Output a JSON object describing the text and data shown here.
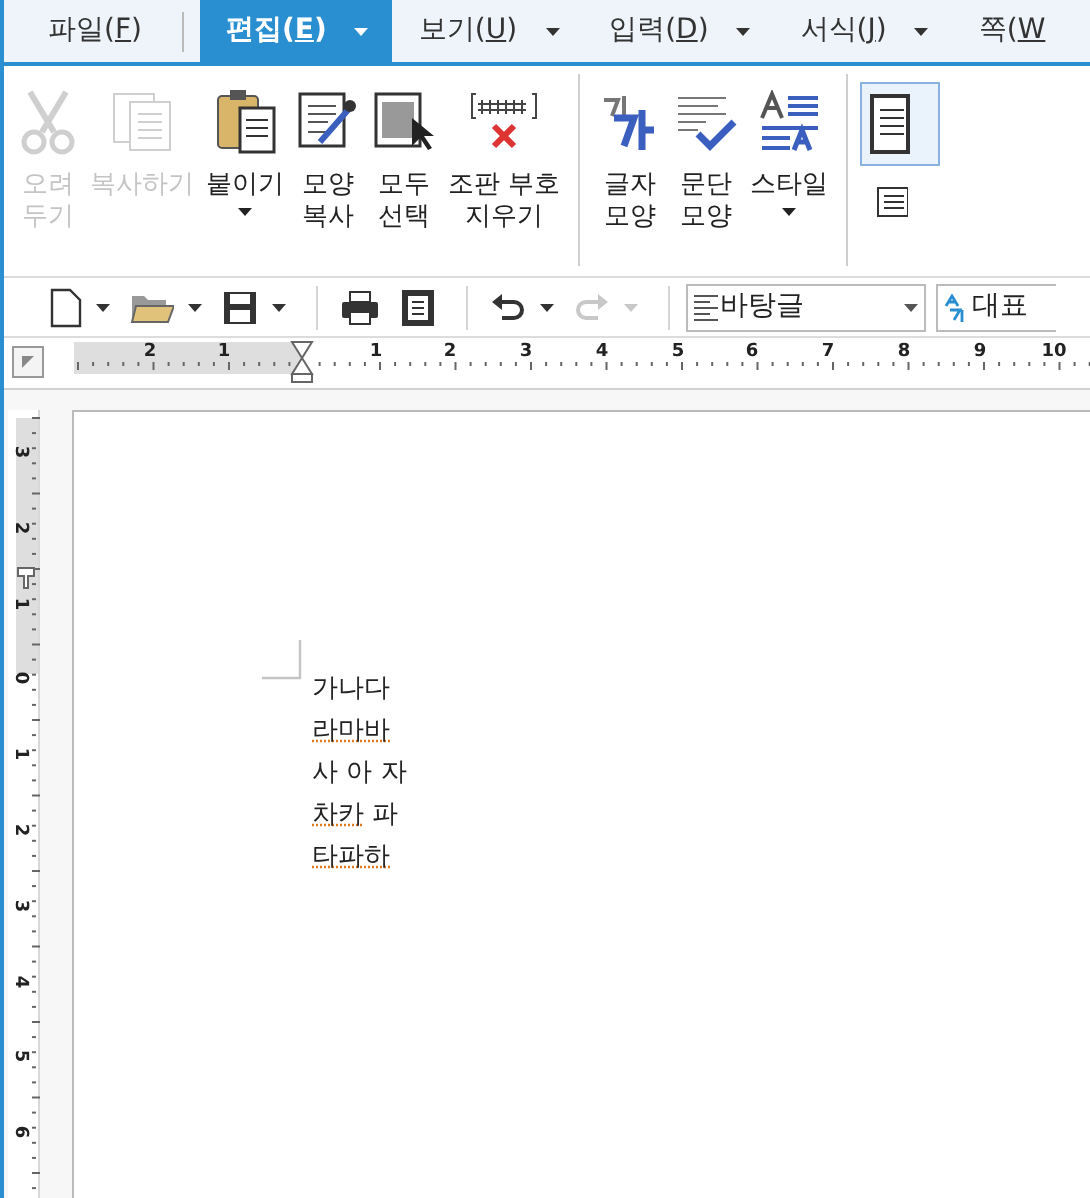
{
  "menu_tabs": [
    {
      "prefix": "파일(",
      "mnemonic": "F",
      "suffix": ")",
      "selected": false,
      "dropdown": false
    },
    {
      "prefix": "편집(",
      "mnemonic": "E",
      "suffix": ")",
      "selected": true,
      "dropdown": true
    },
    {
      "prefix": "보기(",
      "mnemonic": "U",
      "suffix": ")",
      "selected": false,
      "dropdown": true
    },
    {
      "prefix": "입력(",
      "mnemonic": "D",
      "suffix": ")",
      "selected": false,
      "dropdown": true
    },
    {
      "prefix": "서식(",
      "mnemonic": "J",
      "suffix": ")",
      "selected": false,
      "dropdown": true
    },
    {
      "prefix": "쪽(",
      "mnemonic": "W",
      "selected": false,
      "dropdown": false
    }
  ],
  "ribbon_groups": [
    [
      {
        "kind": "cut",
        "label": "오려\n두기",
        "disabled": true,
        "dropdown": false
      },
      {
        "kind": "copy",
        "label": "복사하기",
        "disabled": true,
        "dropdown": false
      },
      {
        "kind": "paste",
        "label": "붙이기",
        "disabled": false,
        "dropdown": true
      },
      {
        "kind": "format-painter",
        "label": "모양\n복사",
        "disabled": false,
        "dropdown": false
      },
      {
        "kind": "select-all",
        "label": "모두\n선택",
        "disabled": false,
        "dropdown": false
      },
      {
        "kind": "clear-codes",
        "label": "조판 부호\n지우기",
        "disabled": false,
        "dropdown": false
      }
    ],
    [
      {
        "kind": "char-shape",
        "label": "글자\n모양",
        "disabled": false,
        "dropdown": false
      },
      {
        "kind": "para-shape",
        "label": "문단\n모양",
        "disabled": false,
        "dropdown": false
      },
      {
        "kind": "style",
        "label": "스타일",
        "disabled": false,
        "dropdown": true
      }
    ]
  ],
  "toolbar_groups": [
    [
      {
        "kind": "new",
        "disabled": false,
        "dropdown": true
      },
      {
        "kind": "open",
        "disabled": false,
        "dropdown": true
      },
      {
        "kind": "save",
        "disabled": false,
        "dropdown": true
      }
    ],
    [
      {
        "kind": "print",
        "disabled": false,
        "dropdown": false
      },
      {
        "kind": "preview",
        "disabled": false,
        "dropdown": false
      }
    ],
    [
      {
        "kind": "undo",
        "disabled": false,
        "dropdown": true
      },
      {
        "kind": "redo",
        "disabled": true,
        "dropdown": true
      }
    ]
  ],
  "style_select": {
    "value": "바탕글"
  },
  "font_select": {
    "value": "대표"
  },
  "horizontal_ruler": {
    "labels": [
      "2",
      "1",
      "1",
      "2",
      "3",
      "4",
      "5",
      "6",
      "7",
      "8",
      "9",
      "10"
    ]
  },
  "vertical_ruler": {
    "labels": [
      "3",
      "2",
      "1",
      "0",
      "1",
      "2",
      "3",
      "4",
      "5",
      "6"
    ]
  },
  "document": {
    "lines": [
      [
        {
          "text": "가나다",
          "spell_error": false
        }
      ],
      [
        {
          "text": "라마바",
          "spell_error": true
        }
      ],
      [
        {
          "text": "사 아 자",
          "spell_error": false
        }
      ],
      [
        {
          "text": "차카",
          "spell_error": true
        },
        {
          "text": " 파",
          "spell_error": false
        }
      ],
      [
        {
          "text": "타파하",
          "spell_error": true
        }
      ]
    ]
  }
}
